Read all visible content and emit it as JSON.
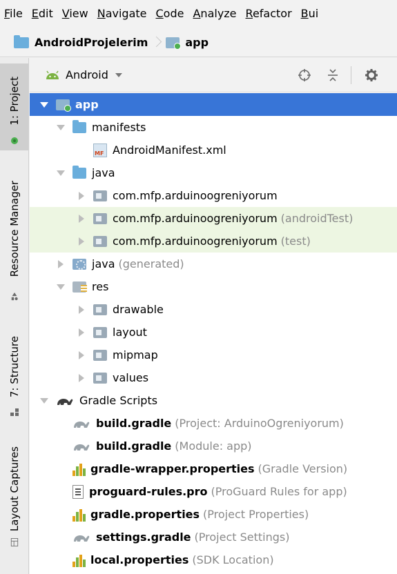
{
  "menubar": {
    "items": [
      "File",
      "Edit",
      "View",
      "Navigate",
      "Code",
      "Analyze",
      "Refactor",
      "Bui"
    ]
  },
  "breadcrumb": {
    "project": "AndroidProjelerim",
    "module": "app"
  },
  "toolstrip": {
    "tabs": [
      {
        "label": "1: Project",
        "active": true
      },
      {
        "label": "Resource Manager",
        "active": false
      },
      {
        "label": "7: Structure",
        "active": false
      },
      {
        "label": "Layout Captures",
        "active": false
      }
    ]
  },
  "panel": {
    "view_mode": "Android",
    "tree": [
      {
        "label": "app",
        "suffix": "",
        "depth": 0,
        "arrow": "down",
        "icon": "app-module-icon",
        "bold": true,
        "selected": true
      },
      {
        "label": "manifests",
        "suffix": "",
        "depth": 1,
        "arrow": "down",
        "icon": "folder-icon",
        "bold": false
      },
      {
        "label": "AndroidManifest.xml",
        "suffix": "",
        "depth": 2,
        "arrow": "none",
        "icon": "manifest-file-icon",
        "bold": false
      },
      {
        "label": "java",
        "suffix": "",
        "depth": 1,
        "arrow": "down",
        "icon": "folder-icon",
        "bold": false
      },
      {
        "label": "com.mfp.arduinoogreniyorum",
        "suffix": "",
        "depth": 2,
        "arrow": "right",
        "icon": "package-icon",
        "bold": false
      },
      {
        "label": "com.mfp.arduinoogreniyorum",
        "suffix": "(androidTest)",
        "depth": 2,
        "arrow": "right",
        "icon": "package-icon",
        "bold": false,
        "highlight": true
      },
      {
        "label": "com.mfp.arduinoogreniyorum",
        "suffix": "(test)",
        "depth": 2,
        "arrow": "right",
        "icon": "package-icon",
        "bold": false,
        "highlight": true
      },
      {
        "label": "java",
        "suffix": "(generated)",
        "depth": 1,
        "arrow": "right",
        "icon": "generated-folder-icon",
        "bold": false
      },
      {
        "label": "res",
        "suffix": "",
        "depth": 1,
        "arrow": "down",
        "icon": "res-folder-icon",
        "bold": false
      },
      {
        "label": "drawable",
        "suffix": "",
        "depth": 2,
        "arrow": "right",
        "icon": "package-icon",
        "bold": false
      },
      {
        "label": "layout",
        "suffix": "",
        "depth": 2,
        "arrow": "right",
        "icon": "package-icon",
        "bold": false
      },
      {
        "label": "mipmap",
        "suffix": "",
        "depth": 2,
        "arrow": "right",
        "icon": "package-icon",
        "bold": false
      },
      {
        "label": "values",
        "suffix": "",
        "depth": 2,
        "arrow": "right",
        "icon": "package-icon",
        "bold": false
      },
      {
        "label": "Gradle Scripts",
        "suffix": "",
        "depth": 0,
        "arrow": "down",
        "icon": "gradle-icon",
        "bold": false
      },
      {
        "label": "build.gradle",
        "suffix": "(Project: ArduinoOgreniyorum)",
        "depth": 1,
        "arrow": "none",
        "icon": "gradle-file-icon",
        "bold": true
      },
      {
        "label": "build.gradle",
        "suffix": "(Module: app)",
        "depth": 1,
        "arrow": "none",
        "icon": "gradle-file-icon",
        "bold": true
      },
      {
        "label": "gradle-wrapper.properties",
        "suffix": "(Gradle Version)",
        "depth": 1,
        "arrow": "none",
        "icon": "properties-file-icon",
        "bold": true
      },
      {
        "label": "proguard-rules.pro",
        "suffix": "(ProGuard Rules for app)",
        "depth": 1,
        "arrow": "none",
        "icon": "proguard-file-icon",
        "bold": true
      },
      {
        "label": "gradle.properties",
        "suffix": "(Project Properties)",
        "depth": 1,
        "arrow": "none",
        "icon": "properties-file-icon",
        "bold": true
      },
      {
        "label": "settings.gradle",
        "suffix": "(Project Settings)",
        "depth": 1,
        "arrow": "none",
        "icon": "gradle-file-icon",
        "bold": true
      },
      {
        "label": "local.properties",
        "suffix": "(SDK Location)",
        "depth": 1,
        "arrow": "none",
        "icon": "properties-file-icon",
        "bold": true
      }
    ]
  },
  "colors": {
    "selection": "#3875d7",
    "highlight_row": "#edf6e2",
    "muted_text": "#8a8a8a",
    "folder_blue": "#6aaedc"
  }
}
